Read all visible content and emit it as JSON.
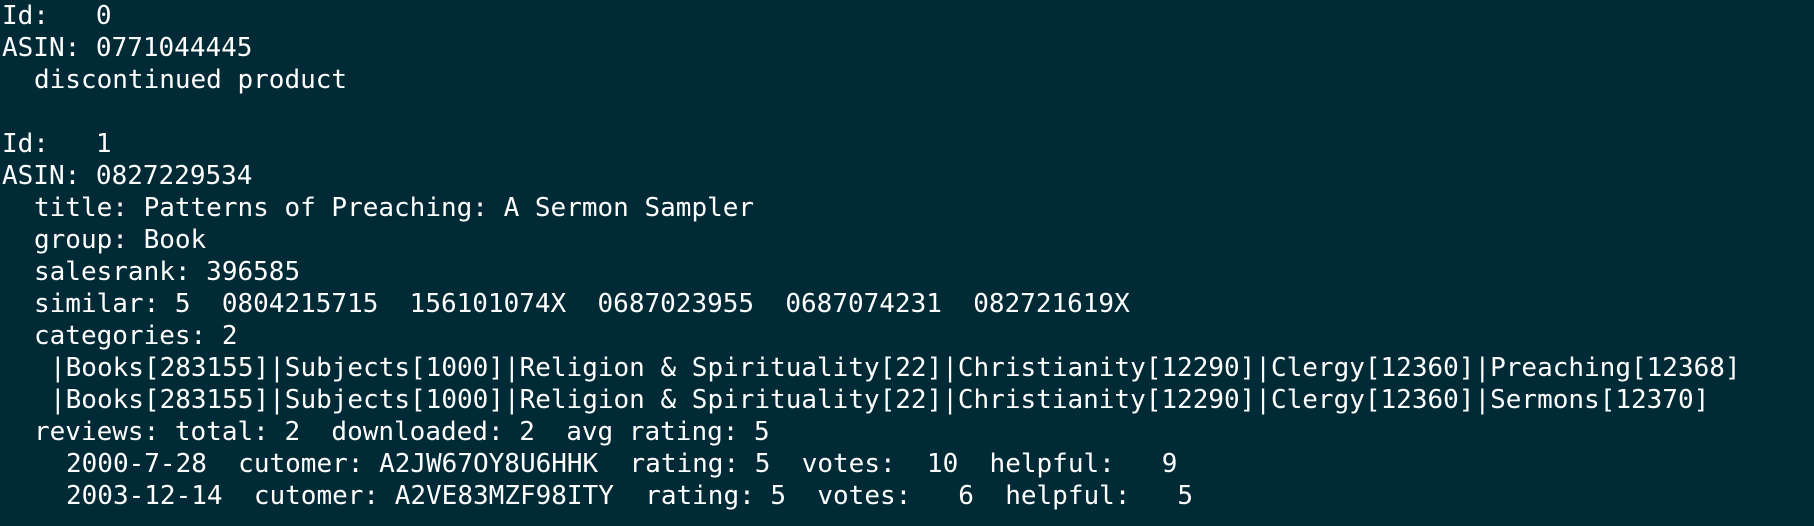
{
  "terminal": {
    "records": [
      {
        "id_line": "Id:   0",
        "asin_line": "ASIN: 0771044445",
        "status_line": "discontinued product"
      },
      {
        "id_line": "Id:   1",
        "asin_line": "ASIN: 0827229534",
        "title_line": "title: Patterns of Preaching: A Sermon Sampler",
        "group_line": "group: Book",
        "salesrank_line": "salesrank: 396585",
        "similar_line": "similar: 5  0804215715  156101074X  0687023955  0687074231  082721619X",
        "categories_line": "categories: 2",
        "category_paths": [
          "|Books[283155]|Subjects[1000]|Religion & Spirituality[22]|Christianity[12290]|Clergy[12360]|Preaching[12368]",
          "|Books[283155]|Subjects[1000]|Religion & Spirituality[22]|Christianity[12290]|Clergy[12360]|Sermons[12370]"
        ],
        "reviews_line": "reviews: total: 2  downloaded: 2  avg rating: 5",
        "review_lines": [
          "2000-7-28  cutomer: A2JW67OY8U6HHK  rating: 5  votes:  10  helpful:   9",
          "2003-12-14  cutomer: A2VE83MZF98ITY  rating: 5  votes:   6  helpful:   5"
        ]
      }
    ]
  },
  "colors": {
    "background": "#002b36",
    "text": "#ffffff"
  }
}
